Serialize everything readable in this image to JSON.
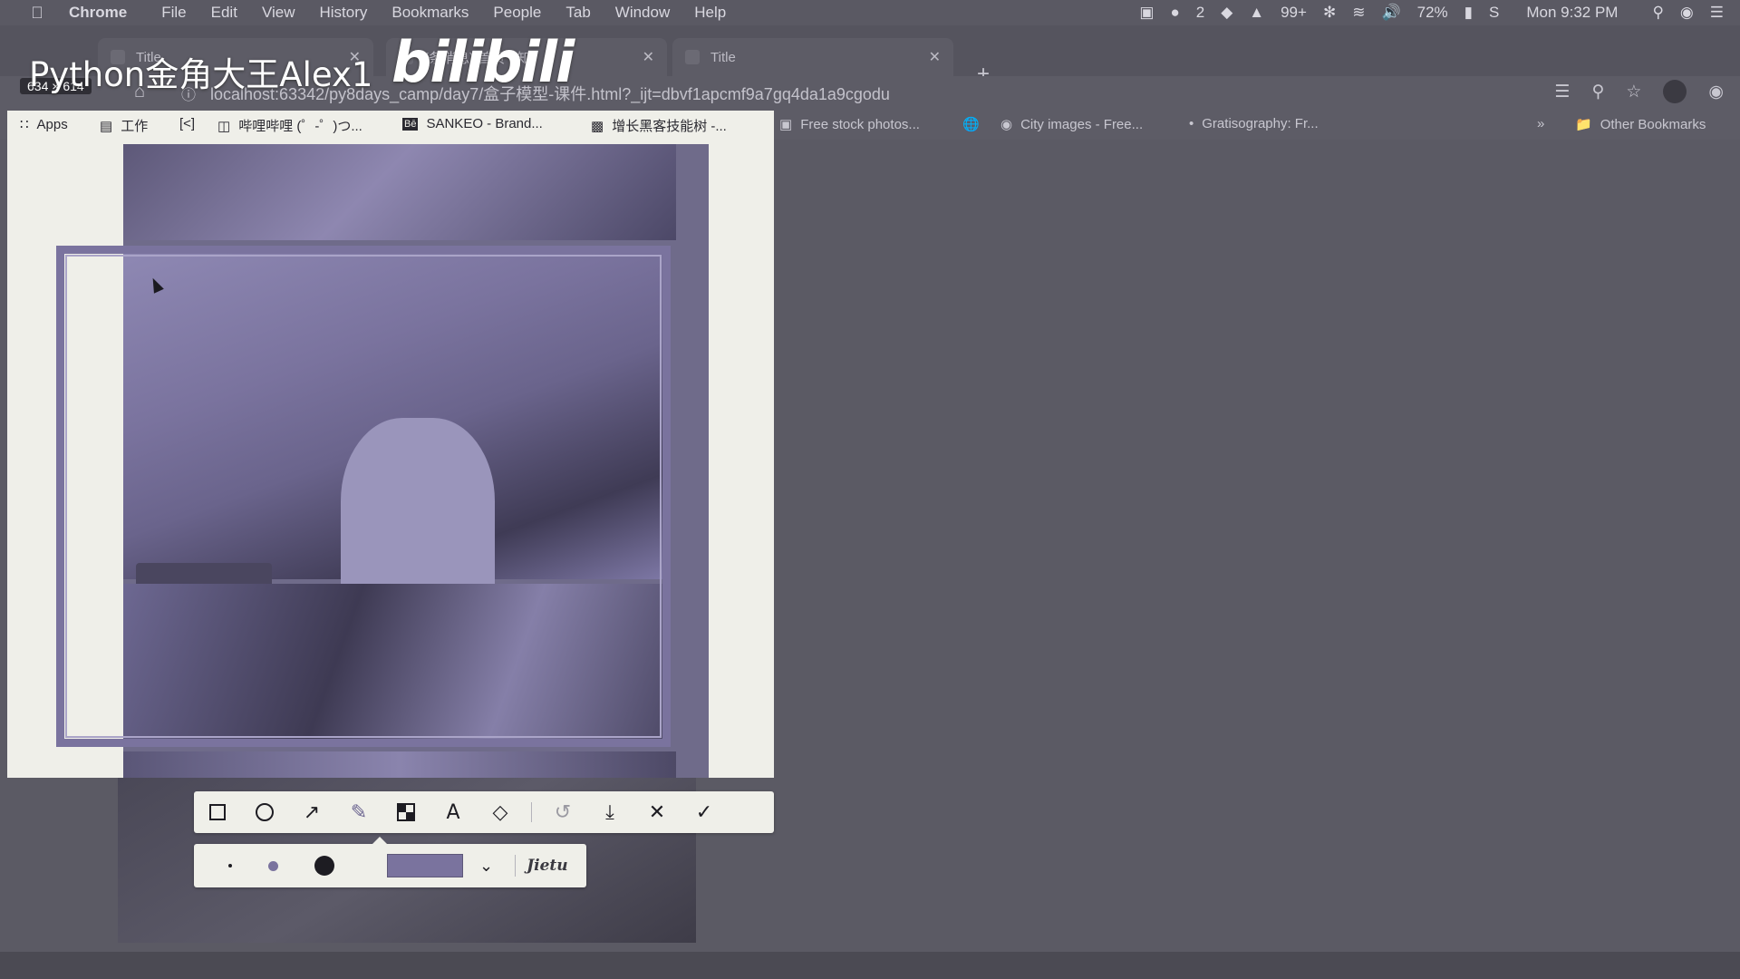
{
  "menubar": {
    "app_name": "Chrome",
    "items": [
      "File",
      "Edit",
      "View",
      "History",
      "Bookmarks",
      "People",
      "Tab",
      "Window",
      "Help"
    ],
    "status": {
      "badge_count": "2",
      "notifications": "99+",
      "battery": "72%",
      "clock": "Mon 9:32 PM"
    }
  },
  "watermark": {
    "text": "Python金角大王Alex1",
    "logo": "bilibili"
  },
  "selection_size": "634 × 614",
  "tabs": [
    {
      "title": "Title"
    },
    {
      "title": "(条消息) 首页 - 知"
    },
    {
      "title": "Title"
    }
  ],
  "omnibox": {
    "url": "localhost:63342/py8days_camp/day7/盒子模型-课件.html?_ijt=dbvf1apcmf9a7gq4da1a9cgodu"
  },
  "bookmarks": [
    {
      "label": "Apps",
      "icon": "apps-grid-icon"
    },
    {
      "label": "工作",
      "icon": "folder-icon"
    },
    {
      "label": "",
      "icon": "code-bracket-icon"
    },
    {
      "label": "哔哩哔哩 (゜-゜)つ...",
      "icon": "tv-icon"
    },
    {
      "label": "SANKEO - Brand...",
      "icon": "behance-icon"
    },
    {
      "label": "增长黑客技能树 -...",
      "icon": "box-icon"
    },
    {
      "label": "Free stock photos...",
      "icon": "image-icon"
    },
    {
      "label": "",
      "icon": "globe-icon"
    },
    {
      "label": "City images - Free...",
      "icon": "camera-icon"
    },
    {
      "label": "Gratisography: Fr...",
      "icon": "dot-icon"
    }
  ],
  "bookmarks_overflow": "»",
  "other_bookmarks": "Other Bookmarks",
  "screenshot_tool": {
    "tools": [
      "rectangle",
      "ellipse",
      "arrow",
      "pen",
      "mosaic",
      "text",
      "eraser",
      "undo",
      "download",
      "cancel",
      "confirm"
    ],
    "active_tool": "pen",
    "pen_color": "#7a739e",
    "brand": "Jietu"
  }
}
